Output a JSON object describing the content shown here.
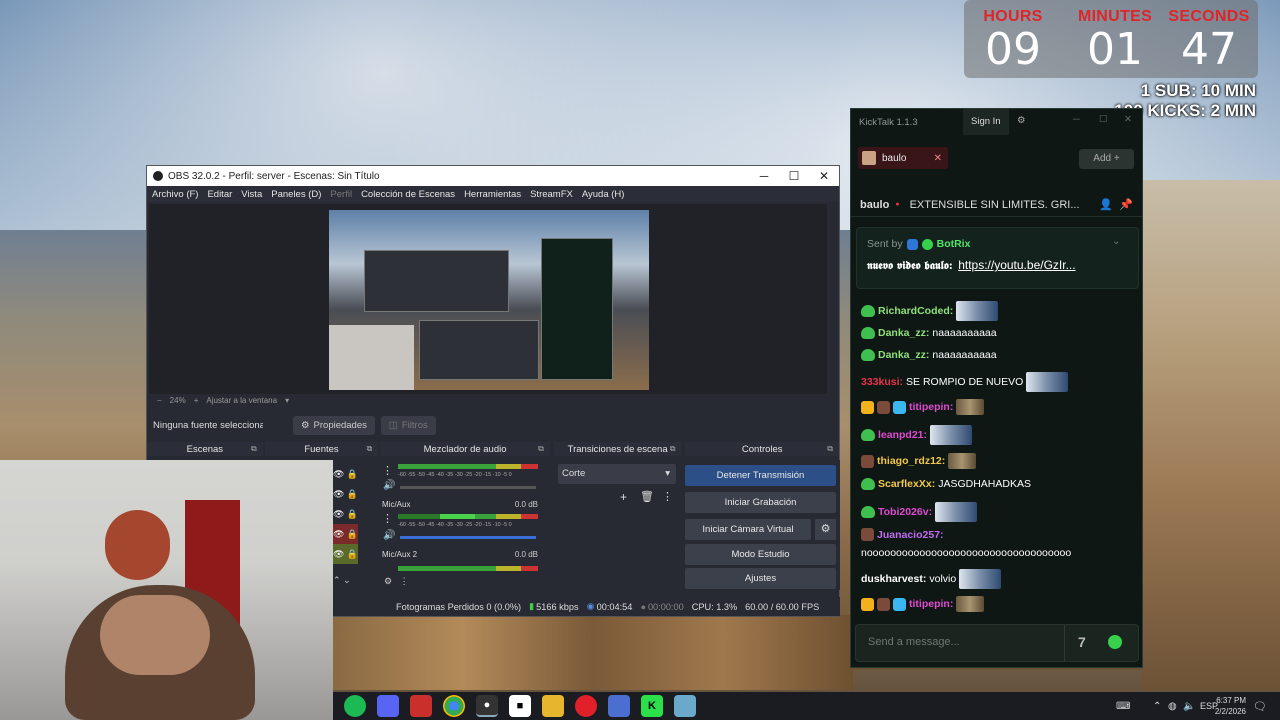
{
  "timer": {
    "labels": [
      "HOURS",
      "MINUTES",
      "SECONDS"
    ],
    "values": [
      "09",
      "01",
      "47"
    ],
    "goals": [
      "1 SUB: 10 MIN",
      "100 KICKS: 2 MIN"
    ],
    "label_color": "#e0242a"
  },
  "obs": {
    "title": "OBS 32.0.2 - Perfil: server - Escenas: Sin Título",
    "menu": [
      "Archivo (F)",
      "Editar",
      "Vista",
      "Paneles (D)",
      "Perfil",
      "Colección de Escenas",
      "Herramientas",
      "StreamFX",
      "Ayuda (H)"
    ],
    "zoom": "24%",
    "zoom_mode": "Ajustar a la ventana",
    "no_source": "Ninguna fuente seleccionad",
    "properties": "Propiedades",
    "filters": "Filtros",
    "docks": {
      "scenes": "Escenas",
      "sources": "Fuentes",
      "mixer": "Mezclador de audio",
      "transitions": "Transiciones de escena",
      "controls": "Controles"
    },
    "mixer": {
      "ticks": "-60 -55 -50 -45 -40 -35 -30 -25 -20 -15 -10 -5 0",
      "channels": [
        {
          "name": "Mic/Aux",
          "db": "0.0 dB"
        },
        {
          "name": "Mic/Aux 2",
          "db": "0.0 dB"
        }
      ]
    },
    "transition": "Corte",
    "controls": [
      "Detener Transmisión",
      "Iniciar Grabación",
      "Iniciar Cámara Virtual",
      "Modo Estudio",
      "Ajustes"
    ],
    "status": {
      "dropped": "Fotogramas Perdidos 0 (0.0%)",
      "bitrate": "5166 kbps",
      "stream_time": "00:04:54",
      "rec_time": "00:00:00",
      "cpu": "CPU: 1.3%",
      "fps": "60.00 / 60.00 FPS"
    }
  },
  "kicktalk": {
    "title": "KickTalk 1.1.3",
    "sign_in": "Sign In",
    "tab_name": "baulo",
    "add_label": "Add",
    "channel": "baulo",
    "stream_title": "EXTENSIBLE SIN LIMITES. GRI...",
    "pinned": {
      "sent_by": "Sent by",
      "bot": "BotRix",
      "text": "𝖓𝖚𝖊𝖛𝖔 𝖛𝖎𝖉𝖊𝖔 𝖇𝖆𝖚𝖑𝖔:",
      "link": "https://youtu.be/GzIr..."
    },
    "messages": [
      {
        "user": "RichardCoded:",
        "text": "",
        "color": "#8fe07a"
      },
      {
        "user": "Danka_zz:",
        "text": "naaaaaaaaaa",
        "color": "#8fe07a"
      },
      {
        "user": "Danka_zz:",
        "text": "naaaaaaaaaa",
        "color": "#8fe07a"
      },
      {
        "user": "333kusi:",
        "text": "SE ROMPIO DE NUEVO",
        "color": "#e8334a"
      },
      {
        "user": "titipepin:",
        "text": "",
        "color": "#e04ad0"
      },
      {
        "user": "leanpd21:",
        "text": "",
        "color": "#e04ad0"
      },
      {
        "user": "thiago_rdz12:",
        "text": "",
        "color": "#f2c84b"
      },
      {
        "user": "ScarflexXx:",
        "text": "JASGDHAHADKAS",
        "color": "#f2c84b"
      },
      {
        "user": "Tobi2026v:",
        "text": "",
        "color": "#e04ad0"
      },
      {
        "user": "Juanacio257:",
        "text": "",
        "color": "#c06cf0"
      },
      {
        "user": "",
        "text": "nooooooooooooooooooooooooooooooooooo",
        "color": "#ffffff"
      },
      {
        "user": "duskharvest:",
        "text": "volvio",
        "color": "#ffffff"
      },
      {
        "user": "titipepin:",
        "text": "",
        "color": "#e04ad0"
      }
    ],
    "input_placeholder": "Send a message..."
  },
  "taskbar": {
    "lang": "ESP",
    "time": "6:37 PM",
    "date": "2/2/2026"
  }
}
